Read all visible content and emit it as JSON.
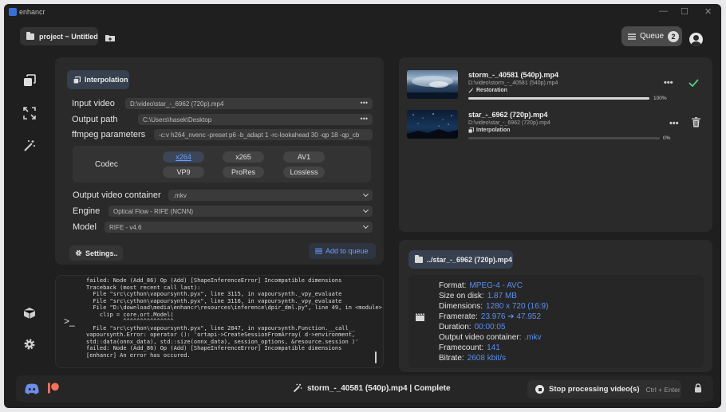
{
  "window": {
    "title": "enhancr",
    "controls": [
      "—",
      "☐",
      "✕"
    ]
  },
  "header": {
    "project_label": "project ~ Untitled",
    "queue_label": "Queue",
    "queue_count": "2"
  },
  "main": {
    "mode_label": "Interpolation",
    "input_video_label": "Input video",
    "input_video_value": "D:\\video\\star_-_6962 (720p).mp4",
    "output_path_label": "Output path",
    "output_path_value": "C:\\Users\\hasek\\Desktop",
    "ffmpeg_label": "ffmpeg parameters",
    "ffmpeg_value": "-c:v h264_nvenc -preset p6 -b_adapt 1 -rc-lookahead 30 -qp 18 -qp_cb",
    "codec_label": "Codec",
    "codecs": [
      "x264",
      "x265",
      "AV1",
      "VP9",
      "ProRes",
      "Lossless"
    ],
    "selected_codec": "x264",
    "container_label": "Output video container",
    "container_value": ".mkv",
    "engine_label": "Engine",
    "engine_value": "Optical Flow - RIFE (NCNN)",
    "model_label": "Model",
    "model_value": "RIFE - v4.6",
    "settings_label": "Settings..",
    "add_queue_label": "Add to queue"
  },
  "log": {
    "prompt": ">_",
    "lines": [
      "failed: Node (Add_86) Op (Add) [ShapeInferenceError] Incompatible dimensions",
      "",
      "Traceback (most recent call last):",
      "  File \"src\\cython\\vapoursynth.pyx\", line 3115, in vapoursynth._vpy_evaluate",
      "  File \"src\\cython\\vapoursynth.pyx\", line 3116, in vapoursynth._vpy_evaluate",
      "  File \"D:\\download\\media\\enhancr\\resources\\inference\\dpir_dml.py\", line 49, in <module>",
      "    clip = core.ort.Model(",
      "           ^^^^^^^^^^^^^^^",
      "  File \"src\\cython\\vapoursynth.pyx\", line 2847, in vapoursynth.Function.__call__",
      "vapoursynth.Error: operator (): 'ortapi->CreateSessionFromArray( d->environment,",
      "std::data(onnx_data), std::size(onnx_data), session_options, &resource.session )'",
      "failed: Node (Add_86) Op (Add) [ShapeInferenceError] Incompatible dimensions",
      "[enhancr] An error has occured."
    ]
  },
  "queue": {
    "items": [
      {
        "title": "storm_-_40581 (540p).mp4",
        "path": "D:\\video\\storm_-_40581 (540p).mp4",
        "type": "Restoration",
        "progress": 100,
        "progress_label": "100%"
      },
      {
        "title": "star_-_6962 (720p).mp4",
        "path": "D:\\video\\star_-_6962 (720p).mp4",
        "type": "Interpolation",
        "progress": 0,
        "progress_label": "0%"
      }
    ]
  },
  "info": {
    "file_label": "../star_-_6962 (720p).mp4",
    "rows": [
      {
        "label": "Format:",
        "value": "MPEG-4 - AVC"
      },
      {
        "label": "Size on disk:",
        "value": "1.87 MB"
      },
      {
        "label": "Dimensions:",
        "value": "1280 x 720 (16:9)"
      },
      {
        "label": "Framerate:",
        "value": "23.976 ➔ 47.952"
      },
      {
        "label": "Duration:",
        "value": "00:00:05"
      },
      {
        "label": "Output video container:",
        "value": ".mkv"
      },
      {
        "label": "Framecount:",
        "value": "141"
      },
      {
        "label": "Bitrate:",
        "value": "2608 kbit/s"
      }
    ]
  },
  "bottom": {
    "status": "storm_-_40581 (540p).mp4 | Complete",
    "stop_label": "Stop processing video(s)",
    "stop_shortcut": "Ctrl + Enter"
  },
  "colors": {
    "accent": "#5a8ef0",
    "background": "#1f1f1f",
    "panel": "#2a2a2a"
  }
}
